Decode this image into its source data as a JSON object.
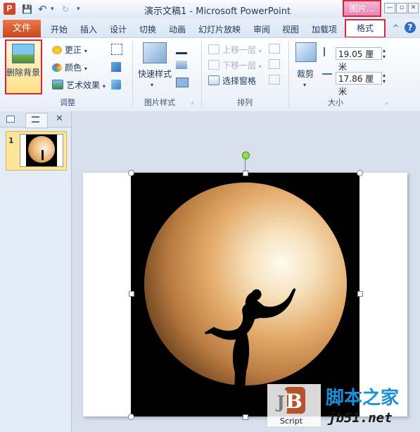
{
  "app": {
    "icon_letter": "P",
    "title": "演示文稿1 - Microsoft PowerPoint",
    "context_tab": "图片...",
    "qat": {
      "save": "💾",
      "undo": "↶",
      "undo_arrow": "▾",
      "redo": "↻",
      "customize": "▾"
    },
    "window": {
      "min": "—",
      "max": "▫",
      "close": "✕"
    },
    "help": "?",
    "ribbon_toggle": "^"
  },
  "tabs": {
    "file": "文件",
    "items": [
      "开始",
      "插入",
      "设计",
      "切换",
      "动画",
      "幻灯片放映",
      "审阅",
      "视图",
      "加载项"
    ],
    "format": "格式"
  },
  "ribbon": {
    "adjust": {
      "remove_bg": "删除背景",
      "corrections": "更正",
      "color": "颜色",
      "artistic": "艺术效果",
      "label": "调整"
    },
    "styles": {
      "quick_styles": "快速样式",
      "label": "图片样式"
    },
    "arrange": {
      "bring_forward": "上移一层",
      "send_backward": "下移一层",
      "selection_pane": "选择窗格",
      "label": "排列"
    },
    "size": {
      "crop": "裁剪",
      "height": "19.05 厘米",
      "width": "17.86 厘米",
      "label": "大小"
    }
  },
  "panel": {
    "slide_number": "1",
    "close": "✕"
  },
  "watermark": {
    "logo_text": "Script",
    "site_name": "脚本之家",
    "domain": "jb51.net"
  },
  "colors": {
    "accent": "#d8263f",
    "file_tab": "#c8471d",
    "ribbon_text": "#1e395b"
  }
}
